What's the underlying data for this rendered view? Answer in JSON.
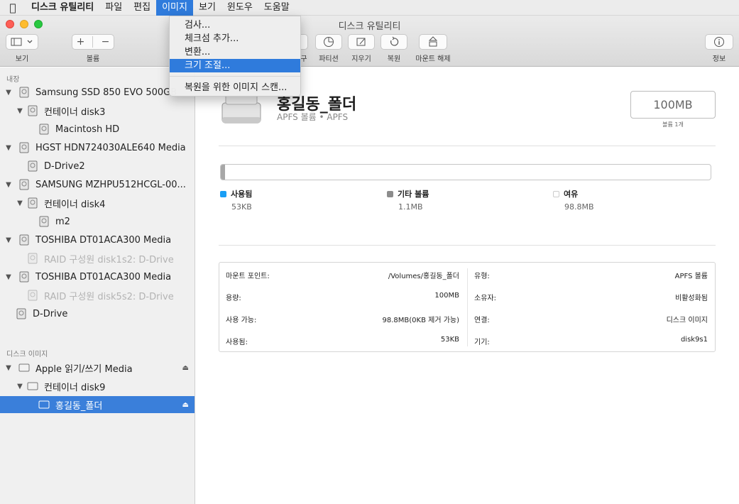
{
  "menubar": {
    "items": [
      {
        "label": "디스크 유틸리티"
      },
      {
        "label": "파일"
      },
      {
        "label": "편집"
      },
      {
        "label": "이미지"
      },
      {
        "label": "보기"
      },
      {
        "label": "윈도우"
      },
      {
        "label": "도움말"
      }
    ],
    "active": "이미지"
  },
  "image_menu": {
    "items": [
      "검사...",
      "체크섬 추가...",
      "변환...",
      "크기 조절...",
      "복원을 위한 이미지 스캔..."
    ],
    "highlighted": "크기 조절..."
  },
  "window": {
    "title": "디스크 유틸리티"
  },
  "toolbar": {
    "view_label": "보기",
    "volume_label": "볼륨",
    "first_aid_label_partial": "구",
    "partition_label": "파티션",
    "erase_label": "지우기",
    "restore_label": "복원",
    "unmount_label": "마운트 해제",
    "info_label": "정보"
  },
  "sidebar": {
    "sections": [
      "내장",
      "디스크 이미지"
    ],
    "items": [
      {
        "label": "Samsung SSD 850 EVO 500GB",
        "level": 0,
        "expanded": true,
        "dim": false,
        "selected": false
      },
      {
        "label": "컨테이너 disk3",
        "level": 1,
        "expanded": true,
        "dim": false,
        "selected": false
      },
      {
        "label": "Macintosh HD",
        "level": 2,
        "dim": false,
        "selected": false
      },
      {
        "label": "HGST HDN724030ALE640 Media",
        "level": 0,
        "expanded": true,
        "dim": false,
        "selected": false
      },
      {
        "label": "D-Drive2",
        "level": 1,
        "dim": false,
        "selected": false
      },
      {
        "label": "SAMSUNG MZHPU512HCGL-00...",
        "level": 0,
        "expanded": true,
        "dim": false,
        "selected": false
      },
      {
        "label": "컨테이너 disk4",
        "level": 1,
        "expanded": true,
        "dim": false,
        "selected": false
      },
      {
        "label": "m2",
        "level": 2,
        "dim": false,
        "selected": false
      },
      {
        "label": "TOSHIBA DT01ACA300 Media",
        "level": 0,
        "expanded": true,
        "dim": false,
        "selected": false
      },
      {
        "label": "RAID 구성원 disk1s2: D-Drive",
        "level": 1,
        "dim": true,
        "selected": false
      },
      {
        "label": "TOSHIBA DT01ACA300 Media",
        "level": 0,
        "expanded": true,
        "dim": false,
        "selected": false
      },
      {
        "label": "RAID 구성원 disk5s2: D-Drive",
        "level": 1,
        "dim": true,
        "selected": false
      },
      {
        "label": "D-Drive",
        "level": 0,
        "dim": false,
        "selected": false
      },
      {
        "label": "Apple 읽기/쓰기 Media",
        "level": 0,
        "expanded": true,
        "dim": false,
        "selected": false,
        "eject": true
      },
      {
        "label": "컨테이너 disk9",
        "level": 1,
        "expanded": true,
        "dim": false,
        "selected": false
      },
      {
        "label": "홍길동_폴더",
        "level": 2,
        "dim": false,
        "selected": true,
        "eject": true
      }
    ]
  },
  "volume": {
    "name": "홍길동_폴더",
    "subtitle": "APFS 볼륨 • APFS",
    "size": "100MB",
    "size_note": "볼륨 1개"
  },
  "usage": {
    "used_fraction": 0.0053,
    "legend": [
      {
        "label": "사용됨",
        "value": "53KB",
        "color": "#1a9ef5"
      },
      {
        "label": "기타 볼륨",
        "value": "1.1MB",
        "color": "#8c8c8c"
      },
      {
        "label": "여유",
        "value": "98.8MB",
        "color": "#ffffff"
      }
    ]
  },
  "info": {
    "left": [
      {
        "key": "마운트 포인트:",
        "value": "/Volumes/홍길동_폴더"
      },
      {
        "key": "용량:",
        "value": "100MB"
      },
      {
        "key": "사용 가능:",
        "value": "98.8MB(0KB 제거 가능)"
      },
      {
        "key": "사용됨:",
        "value": "53KB"
      }
    ],
    "right": [
      {
        "key": "유형:",
        "value": "APFS 볼륨"
      },
      {
        "key": "소유자:",
        "value": "비활성화됨"
      },
      {
        "key": "연결:",
        "value": "디스크 이미지"
      },
      {
        "key": "기기:",
        "value": "disk9s1"
      }
    ]
  }
}
